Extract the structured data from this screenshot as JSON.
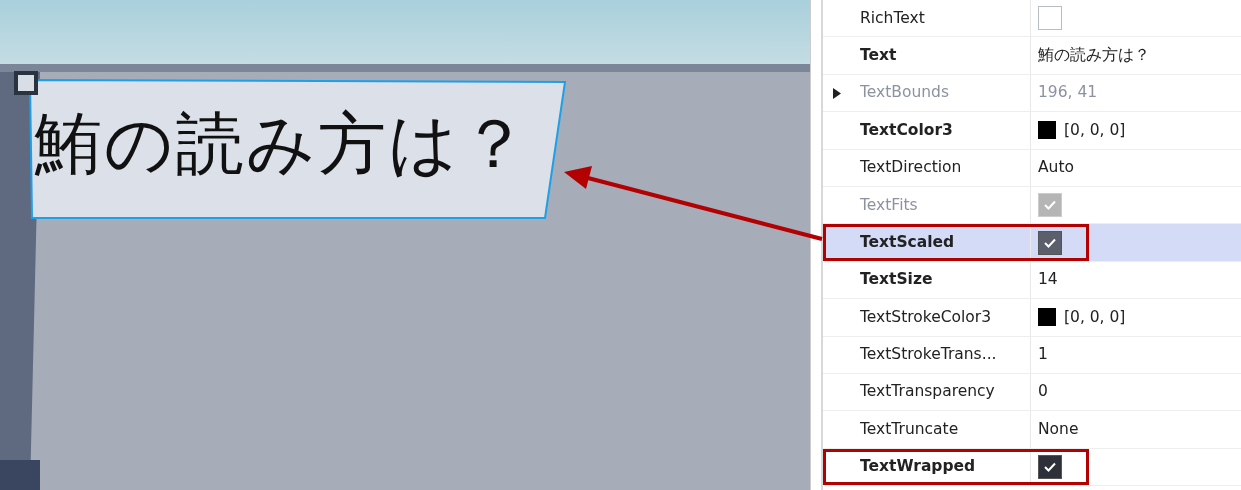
{
  "viewport": {
    "label_text": "鮪の読み方は？",
    "label_selected": true
  },
  "properties": [
    {
      "name": "RichText",
      "bold": false,
      "dim": false,
      "expandable": false,
      "selected": false,
      "outlined": false,
      "kind": "check",
      "checked": false,
      "disabled": false
    },
    {
      "name": "Text",
      "bold": true,
      "dim": false,
      "expandable": false,
      "selected": false,
      "outlined": false,
      "kind": "text",
      "value": "鮪の読み方は？"
    },
    {
      "name": "TextBounds",
      "bold": false,
      "dim": true,
      "expandable": true,
      "selected": false,
      "outlined": false,
      "kind": "text",
      "value": "196, 41"
    },
    {
      "name": "TextColor3",
      "bold": true,
      "dim": false,
      "expandable": false,
      "selected": false,
      "outlined": false,
      "kind": "color",
      "color": "#000000",
      "value": "[0, 0, 0]"
    },
    {
      "name": "TextDirection",
      "bold": false,
      "dim": false,
      "expandable": false,
      "selected": false,
      "outlined": false,
      "kind": "text",
      "value": "Auto"
    },
    {
      "name": "TextFits",
      "bold": false,
      "dim": true,
      "expandable": false,
      "selected": false,
      "outlined": false,
      "kind": "check",
      "checked": true,
      "disabled": true
    },
    {
      "name": "TextScaled",
      "bold": true,
      "dim": false,
      "expandable": false,
      "selected": true,
      "outlined": true,
      "kind": "check",
      "checked": true,
      "disabled": false
    },
    {
      "name": "TextSize",
      "bold": true,
      "dim": false,
      "expandable": false,
      "selected": false,
      "outlined": false,
      "kind": "text",
      "value": "14"
    },
    {
      "name": "TextStrokeColor3",
      "bold": false,
      "dim": false,
      "expandable": false,
      "selected": false,
      "outlined": false,
      "kind": "color",
      "color": "#000000",
      "value": "[0, 0, 0]"
    },
    {
      "name": "TextStrokeTrans...",
      "bold": false,
      "dim": false,
      "expandable": false,
      "selected": false,
      "outlined": false,
      "kind": "text",
      "value": "1"
    },
    {
      "name": "TextTransparency",
      "bold": false,
      "dim": false,
      "expandable": false,
      "selected": false,
      "outlined": false,
      "kind": "text",
      "value": "0"
    },
    {
      "name": "TextTruncate",
      "bold": false,
      "dim": false,
      "expandable": false,
      "selected": false,
      "outlined": false,
      "kind": "text",
      "value": "None"
    },
    {
      "name": "TextWrapped",
      "bold": true,
      "dim": false,
      "expandable": false,
      "selected": false,
      "outlined": true,
      "kind": "check",
      "checked": true,
      "disabled": false
    }
  ]
}
